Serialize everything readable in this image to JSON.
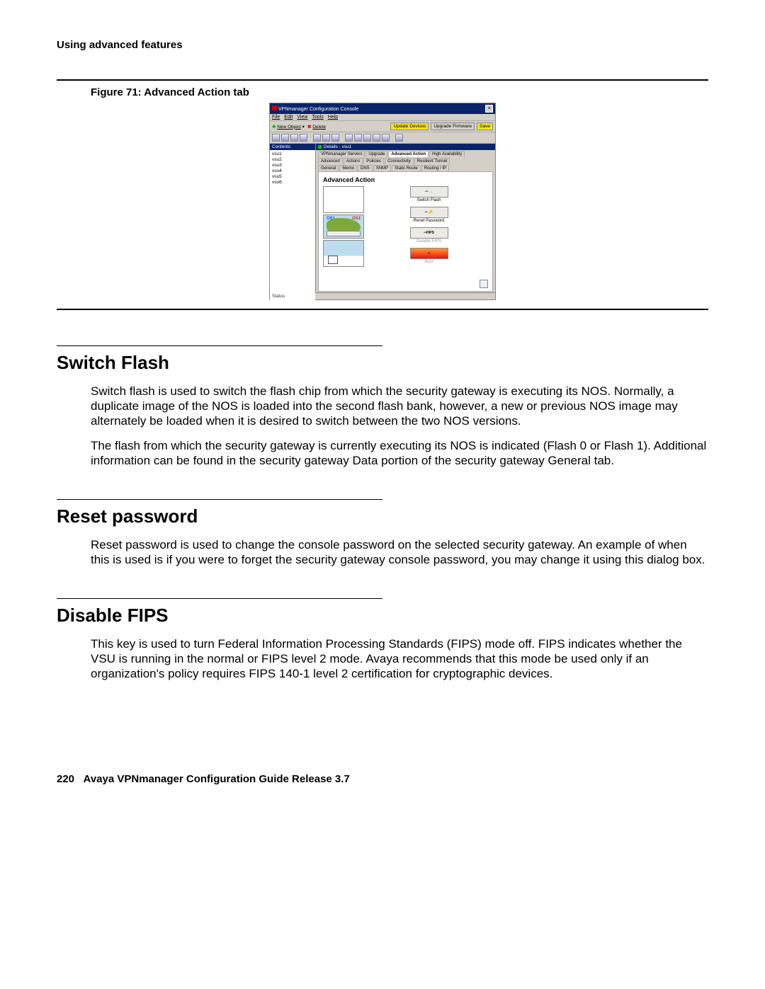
{
  "header": {
    "running": "Using advanced features"
  },
  "figure": {
    "caption": "Figure 71: Advanced Action tab"
  },
  "screenshot": {
    "title": "VPNmanager Configuration Console",
    "menu": [
      "File",
      "Edit",
      "View",
      "Tools",
      "Help"
    ],
    "toolbar": {
      "new_object": "New Object",
      "delete": "Delete",
      "update_devices": "Update Devices",
      "upgrade_firmware": "Upgrade Firmware",
      "save": "Save"
    },
    "sidebar": {
      "header": "Contents",
      "items": [
        "vsu1",
        "vsu2",
        "vsu3",
        "vsu4",
        "vsu5",
        "vsu6"
      ]
    },
    "main": {
      "header": "Details - vsu1",
      "tabs_row1": [
        "VPNmanager Servers",
        "Upgrade",
        "Advanced Action",
        "High Availability"
      ],
      "tabs_row2": [
        "Advanced",
        "Actions",
        "Policies",
        "Connectivity",
        "Resilient Tunnel"
      ],
      "tabs_row3": [
        "General",
        "Memo",
        "DNS",
        "SNMP",
        "Static Route",
        "Routing / IP"
      ],
      "panel_title": "Advanced Action",
      "map_labels": {
        "a": "OS1",
        "b": "OS2"
      },
      "actions": {
        "switch_flash": "Switch Flash",
        "reset_password": "Reset Password",
        "fips_tag": "FIPS",
        "disable_fips": "Disable FIPS",
        "boot": "Boot"
      }
    },
    "status": "Status"
  },
  "sections": {
    "switch_flash": {
      "title": "Switch Flash",
      "p1": "Switch flash is used to switch the flash chip from which the security gateway is executing its NOS. Normally, a duplicate image of the NOS is loaded into the second flash bank, however, a new or previous NOS image may alternately be loaded when it is desired to switch between the two NOS versions.",
      "p2": "The flash from which the security gateway is currently executing its NOS is indicated (Flash 0 or Flash 1). Additional information can be found in the security gateway Data portion of the security gateway General tab."
    },
    "reset_password": {
      "title": "Reset password",
      "p1": "Reset password is used to change the console password on the selected security gateway. An example of when this is used is if you were to forget the security gateway console password, you may change it using this dialog box."
    },
    "disable_fips": {
      "title": "Disable FIPS",
      "p1": "This key is used to turn Federal Information Processing Standards (FIPS) mode off. FIPS indicates whether the VSU is running in the normal or FIPS level 2 mode. Avaya recommends that this mode be used only if an organization's policy requires FIPS 140-1 level 2 certification for cryptographic devices."
    }
  },
  "footer": {
    "page": "220",
    "title": "Avaya VPNmanager Configuration Guide Release 3.7"
  }
}
